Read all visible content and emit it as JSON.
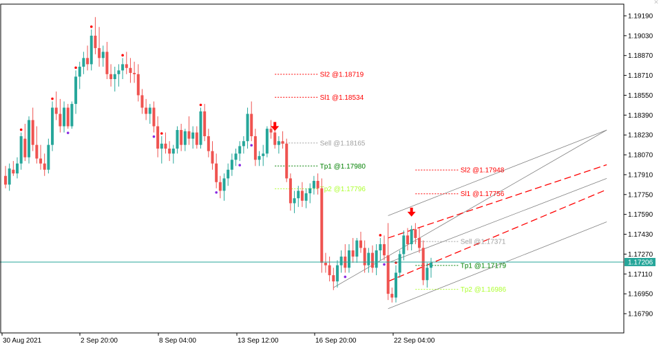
{
  "chart_data": {
    "type": "candlestick",
    "symbol_period": "",
    "y_ticks": [
      "1.19190",
      "1.19030",
      "1.18870",
      "1.18710",
      "1.18550",
      "1.18390",
      "1.18230",
      "1.18070",
      "1.17910",
      "1.17750",
      "1.17590",
      "1.17430",
      "1.17270",
      "1.17110",
      "1.16950",
      "1.16790"
    ],
    "ylim": [
      1.167,
      1.193
    ],
    "x_ticks": [
      "30 Aug 2021",
      "2 Sep 20:00",
      "8 Sep 04:00",
      "13 Sep 12:00",
      "16 Sep 20:00",
      "22 Sep 04:00"
    ],
    "grid": false,
    "colors": {
      "bull": "#26a69a",
      "bear": "#ef5350",
      "current_price_line": "#26a69a",
      "fractal_high": "#ff0000",
      "fractal_low": "#8a2be2",
      "signal_arrow": "#ff0000",
      "sell": "#a0a0a0",
      "sl": "#ff0000",
      "tp1": "#008000",
      "tp2": "#adff2f",
      "channel": "#808080",
      "channel_dashed": "#ff0000"
    },
    "current_price": {
      "label": "1.17206",
      "value": 1.17206
    },
    "candles": [
      [
        1.179,
        1.1798,
        1.178,
        1.1783
      ],
      [
        1.1783,
        1.18,
        1.1778,
        1.1796
      ],
      [
        1.1795,
        1.1802,
        1.179,
        1.1792
      ],
      [
        1.1792,
        1.1805,
        1.1788,
        1.18
      ],
      [
        1.18,
        1.1825,
        1.1795,
        1.1822
      ],
      [
        1.182,
        1.1832,
        1.1802,
        1.1805
      ],
      [
        1.1805,
        1.1838,
        1.18,
        1.1835
      ],
      [
        1.1835,
        1.1845,
        1.181,
        1.1815
      ],
      [
        1.1815,
        1.183,
        1.18,
        1.1804
      ],
      [
        1.1804,
        1.1815,
        1.1795,
        1.18
      ],
      [
        1.18,
        1.1808,
        1.179,
        1.1795
      ],
      [
        1.1795,
        1.182,
        1.1792,
        1.1815
      ],
      [
        1.1815,
        1.185,
        1.181,
        1.1845
      ],
      [
        1.1845,
        1.1858,
        1.1835,
        1.184
      ],
      [
        1.184,
        1.1852,
        1.1825,
        1.183
      ],
      [
        1.183,
        1.185,
        1.1825,
        1.1845
      ],
      [
        1.1845,
        1.1848,
        1.1828,
        1.183
      ],
      [
        1.183,
        1.185,
        1.1828,
        1.1848
      ],
      [
        1.1848,
        1.1875,
        1.184,
        1.187
      ],
      [
        1.187,
        1.1882,
        1.186,
        1.1878
      ],
      [
        1.1878,
        1.189,
        1.1872,
        1.1885
      ],
      [
        1.1885,
        1.1895,
        1.1875,
        1.188
      ],
      [
        1.188,
        1.1908,
        1.1875,
        1.1903
      ],
      [
        1.1903,
        1.1918,
        1.1888,
        1.1893
      ],
      [
        1.1893,
        1.191,
        1.1878,
        1.1885
      ],
      [
        1.1885,
        1.1895,
        1.1878,
        1.189
      ],
      [
        1.189,
        1.1898,
        1.1868,
        1.1872
      ],
      [
        1.1872,
        1.188,
        1.1862,
        1.1868
      ],
      [
        1.1868,
        1.1878,
        1.1858,
        1.1872
      ],
      [
        1.1872,
        1.188,
        1.1862,
        1.1875
      ],
      [
        1.1875,
        1.1885,
        1.1868,
        1.188
      ],
      [
        1.188,
        1.189,
        1.1872,
        1.1877
      ],
      [
        1.1877,
        1.1885,
        1.1865,
        1.1873
      ],
      [
        1.1873,
        1.1882,
        1.1865,
        1.1872
      ],
      [
        1.1872,
        1.188,
        1.185,
        1.1855
      ],
      [
        1.1855,
        1.186,
        1.184,
        1.1845
      ],
      [
        1.1845,
        1.1852,
        1.1835,
        1.184
      ],
      [
        1.184,
        1.1848,
        1.1832,
        1.1845
      ],
      [
        1.1845,
        1.185,
        1.1825,
        1.183
      ],
      [
        1.183,
        1.1838,
        1.1805,
        1.1812
      ],
      [
        1.1812,
        1.1822,
        1.18,
        1.1816
      ],
      [
        1.1816,
        1.1825,
        1.1808,
        1.1812
      ],
      [
        1.1812,
        1.1818,
        1.1802,
        1.1808
      ],
      [
        1.1808,
        1.1815,
        1.18,
        1.1812
      ],
      [
        1.1812,
        1.183,
        1.1808,
        1.1827
      ],
      [
        1.1827,
        1.1832,
        1.181,
        1.1815
      ],
      [
        1.1815,
        1.1828,
        1.181,
        1.1826
      ],
      [
        1.1826,
        1.1838,
        1.1815,
        1.182
      ],
      [
        1.182,
        1.183,
        1.1812,
        1.1825
      ],
      [
        1.1825,
        1.183,
        1.1812,
        1.1815
      ],
      [
        1.1815,
        1.1845,
        1.1812,
        1.1842
      ],
      [
        1.1842,
        1.1848,
        1.1818,
        1.1822
      ],
      [
        1.1822,
        1.1828,
        1.1805,
        1.181
      ],
      [
        1.181,
        1.1818,
        1.1795,
        1.18
      ],
      [
        1.18,
        1.1808,
        1.178,
        1.1785
      ],
      [
        1.1785,
        1.179,
        1.1772,
        1.1778
      ],
      [
        1.1778,
        1.1792,
        1.177,
        1.1788
      ],
      [
        1.1788,
        1.18,
        1.1782,
        1.1795
      ],
      [
        1.1795,
        1.1808,
        1.179,
        1.1803
      ],
      [
        1.1803,
        1.1812,
        1.1798,
        1.1808
      ],
      [
        1.1808,
        1.1818,
        1.1802,
        1.1814
      ],
      [
        1.1814,
        1.1822,
        1.1808,
        1.1818
      ],
      [
        1.1818,
        1.1845,
        1.1812,
        1.184
      ],
      [
        1.184,
        1.185,
        1.1818,
        1.1822
      ],
      [
        1.1822,
        1.1828,
        1.1798,
        1.1803
      ],
      [
        1.1803,
        1.181,
        1.1798,
        1.1806
      ],
      [
        1.1806,
        1.1815,
        1.1798,
        1.1808
      ],
      [
        1.1808,
        1.183,
        1.1805,
        1.1828
      ],
      [
        1.1828,
        1.1835,
        1.182,
        1.1825
      ],
      [
        1.1825,
        1.183,
        1.1812,
        1.1815
      ],
      [
        1.1815,
        1.1822,
        1.1808,
        1.1818
      ],
      [
        1.1818,
        1.1826,
        1.1812,
        1.1816
      ],
      [
        1.1816,
        1.182,
        1.1785,
        1.1788
      ],
      [
        1.1788,
        1.1792,
        1.1762,
        1.1768
      ],
      [
        1.1768,
        1.1778,
        1.176,
        1.1772
      ],
      [
        1.1772,
        1.1782,
        1.1765,
        1.1778
      ],
      [
        1.1778,
        1.1785,
        1.1765,
        1.177
      ],
      [
        1.177,
        1.178,
        1.1764,
        1.1776
      ],
      [
        1.1776,
        1.1784,
        1.1768,
        1.178
      ],
      [
        1.178,
        1.179,
        1.1775,
        1.1786
      ],
      [
        1.1786,
        1.1792,
        1.1775,
        1.178
      ],
      [
        1.178,
        1.1788,
        1.1712,
        1.172
      ],
      [
        1.172,
        1.1728,
        1.1712,
        1.1718
      ],
      [
        1.1718,
        1.1725,
        1.1705,
        1.171
      ],
      [
        1.171,
        1.1716,
        1.1698,
        1.1705
      ],
      [
        1.1705,
        1.1722,
        1.17,
        1.1718
      ],
      [
        1.1718,
        1.173,
        1.1712,
        1.1725
      ],
      [
        1.1725,
        1.1735,
        1.1712,
        1.1716
      ],
      [
        1.1716,
        1.1735,
        1.1712,
        1.173
      ],
      [
        1.173,
        1.174,
        1.172,
        1.1725
      ],
      [
        1.1725,
        1.174,
        1.172,
        1.1738
      ],
      [
        1.1738,
        1.1745,
        1.1728,
        1.1732
      ],
      [
        1.1732,
        1.1738,
        1.1712,
        1.1718
      ],
      [
        1.1718,
        1.1732,
        1.1712,
        1.1728
      ],
      [
        1.1728,
        1.1734,
        1.1712,
        1.1716
      ],
      [
        1.1716,
        1.1735,
        1.171,
        1.173
      ],
      [
        1.173,
        1.174,
        1.1722,
        1.1735
      ],
      [
        1.1735,
        1.1742,
        1.1722,
        1.1726
      ],
      [
        1.1726,
        1.1752,
        1.169,
        1.1695
      ],
      [
        1.1695,
        1.17,
        1.1688,
        1.1692
      ],
      [
        1.1692,
        1.1718,
        1.1688,
        1.1712
      ],
      [
        1.1712,
        1.173,
        1.1708,
        1.1727
      ],
      [
        1.1727,
        1.1746,
        1.1722,
        1.1742
      ],
      [
        1.1742,
        1.1748,
        1.173,
        1.1735
      ],
      [
        1.1735,
        1.175,
        1.173,
        1.1747
      ],
      [
        1.1747,
        1.1752,
        1.1735,
        1.174
      ],
      [
        1.174,
        1.1748,
        1.1728,
        1.1732
      ],
      [
        1.1732,
        1.1738,
        1.1702,
        1.1706
      ],
      [
        1.1706,
        1.172,
        1.17,
        1.1716
      ],
      [
        1.1716,
        1.1724,
        1.1708,
        1.172
      ]
    ],
    "fractal_highs": [
      4,
      12,
      18,
      22,
      30,
      40,
      50,
      96,
      100
    ],
    "fractal_lows": [
      16,
      38,
      54,
      60,
      63,
      87,
      97
    ],
    "signals": [
      {
        "type": "sell",
        "arrow_index": 69,
        "arrow_price": 1.1829,
        "levels_x_index": [
          69,
          80
        ],
        "sl2": {
          "text": "Sl2 @1.18719",
          "price": 1.18719
        },
        "sl1": {
          "text": "Sl1 @1.18534",
          "price": 1.18534
        },
        "sell": {
          "text": "Sell @1.18165",
          "price": 1.18165
        },
        "tp1": {
          "text": "Tp1 @1.17980",
          "price": 1.1798
        },
        "tp2": {
          "text": "Tp2 @1.17796",
          "price": 1.17796
        }
      },
      {
        "type": "sell",
        "arrow_index": 104,
        "arrow_price": 1.176,
        "levels_x_index": [
          105,
          116
        ],
        "sl2": {
          "text": "Sl2 @1.17948",
          "price": 1.17948
        },
        "sl1": {
          "text": "Sl1 @1.17756",
          "price": 1.17756
        },
        "sell": {
          "text": "Sell @1.17371",
          "price": 1.17371
        },
        "tp1": {
          "text": "Tp1 @1.17179",
          "price": 1.17179
        },
        "tp2": {
          "text": "Tp2 @1.16986",
          "price": 1.16986
        }
      }
    ],
    "channels": [
      {
        "style": "solid",
        "from": [
          84,
          1.17
        ],
        "to": [
          154,
          1.1827
        ]
      },
      {
        "style": "solid",
        "from": [
          98,
          1.1683
        ],
        "to": [
          154,
          1.1753
        ]
      },
      {
        "style": "solid",
        "from": [
          98,
          1.1758
        ],
        "to": [
          154,
          1.1827
        ]
      },
      {
        "style": "solid",
        "from": [
          98,
          1.172
        ],
        "to": [
          154,
          1.1788
        ]
      },
      {
        "style": "dashed",
        "from": [
          98,
          1.174
        ],
        "to": [
          154,
          1.1799
        ]
      },
      {
        "style": "dashed",
        "from": [
          98,
          1.1705
        ],
        "to": [
          154,
          1.1779
        ]
      }
    ]
  }
}
